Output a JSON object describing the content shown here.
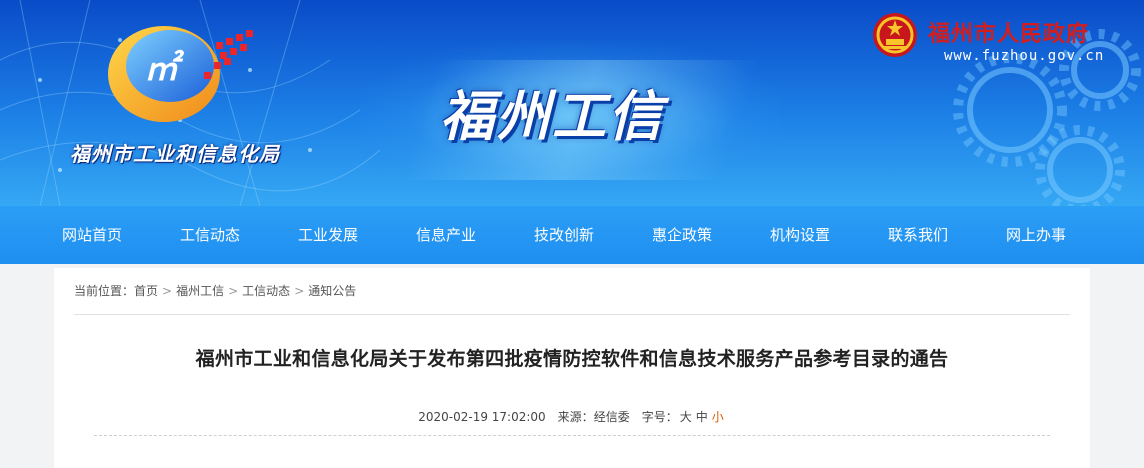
{
  "banner": {
    "org_name": "福州市工业和信息化局",
    "big_title": "福州工信",
    "gov_name": "福州市人民政府",
    "gov_url": "www.fuzhou.gov.cn"
  },
  "nav": {
    "items": [
      "网站首页",
      "工信动态",
      "工业发展",
      "信息产业",
      "技改创新",
      "惠企政策",
      "机构设置",
      "联系我们",
      "网上办事"
    ]
  },
  "breadcrumb": {
    "prefix": "当前位置：",
    "items": [
      "首页",
      "福州工信",
      "工信动态",
      "通知公告"
    ],
    "separator": ">"
  },
  "article": {
    "title": "福州市工业和信息化局关于发布第四批疫情防控软件和信息技术服务产品参考目录的通告",
    "date": "2020-02-19 17:02:00",
    "source_label": "来源：",
    "source": "经信委",
    "font_label": "字号：",
    "font_sizes": [
      "大",
      "中",
      "小"
    ],
    "active_font_size": "小"
  },
  "colors": {
    "nav_bg": "#2196f3",
    "gov_red": "#d41e1e",
    "active_size": "#e05a00"
  }
}
